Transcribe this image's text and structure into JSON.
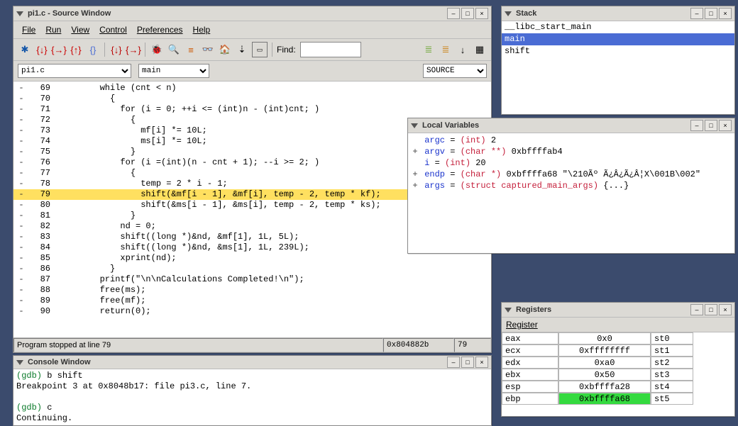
{
  "source_window": {
    "title": "pi1.c - Source Window",
    "menus": [
      "File",
      "Run",
      "View",
      "Control",
      "Preferences",
      "Help"
    ],
    "toolbar_icons": [
      "run-icon",
      "step-icon",
      "next-icon",
      "finish-icon",
      "continue-icon",
      "step-asm-icon",
      "next-asm-icon",
      "bug-icon",
      "search-icon",
      "breakpoints-icon",
      "watch-icon",
      "home-icon",
      "down-icon",
      "terminal-icon"
    ],
    "find_label": "Find:",
    "right_icons": [
      "stack-icon",
      "regs-icon",
      "down-arrow-icon",
      "frame-icon"
    ],
    "file_select": "pi1.c",
    "func_select": "main",
    "mode_select": "SOURCE",
    "code": [
      {
        "n": 69,
        "t": "        while (cnt < n)"
      },
      {
        "n": 70,
        "t": "          {"
      },
      {
        "n": 71,
        "t": "            for (i = 0; ++i <= (int)n - (int)cnt; )"
      },
      {
        "n": 72,
        "t": "              {"
      },
      {
        "n": 73,
        "t": "                mf[i] *= 10L;"
      },
      {
        "n": 74,
        "t": "                ms[i] *= 10L;"
      },
      {
        "n": 75,
        "t": "              }"
      },
      {
        "n": 76,
        "t": "            for (i =(int)(n - cnt + 1); --i >= 2; )"
      },
      {
        "n": 77,
        "t": "              {"
      },
      {
        "n": 78,
        "t": "                temp = 2 * i - 1;"
      },
      {
        "n": 79,
        "t": "                shift(&mf[i - 1], &mf[i], temp - 2, temp * kf);",
        "hl": true
      },
      {
        "n": 80,
        "t": "                shift(&ms[i - 1], &ms[i], temp - 2, temp * ks);"
      },
      {
        "n": 81,
        "t": "              }"
      },
      {
        "n": 82,
        "t": "            nd = 0;"
      },
      {
        "n": 83,
        "t": "            shift((long *)&nd, &mf[1], 1L, 5L);"
      },
      {
        "n": 84,
        "t": "            shift((long *)&nd, &ms[1], 1L, 239L);"
      },
      {
        "n": 85,
        "t": "            xprint(nd);"
      },
      {
        "n": 86,
        "t": "          }"
      },
      {
        "n": 87,
        "t": "        printf(\"\\n\\nCalculations Completed!\\n\");"
      },
      {
        "n": 88,
        "t": "        free(ms);"
      },
      {
        "n": 89,
        "t": "        free(mf);"
      },
      {
        "n": 90,
        "t": "        return(0);"
      }
    ],
    "status_msg": "Program stopped at line 79",
    "status_addr": "0x804882b",
    "status_line": "79"
  },
  "stack_window": {
    "title": "Stack",
    "items": [
      {
        "label": "__libc_start_main",
        "sel": false
      },
      {
        "label": "main",
        "sel": true
      },
      {
        "label": "shift",
        "sel": false
      }
    ]
  },
  "locals_window": {
    "title": "Local Variables",
    "vars": [
      {
        "exp": " ",
        "name": "argc",
        "type": "(int)",
        "val": "2"
      },
      {
        "exp": "+",
        "name": "argv",
        "type": "(char **)",
        "val": "0xbffffab4"
      },
      {
        "exp": " ",
        "name": "i",
        "type": "(int)",
        "val": "20"
      },
      {
        "exp": "+",
        "name": "endp",
        "type": "(char *)",
        "val": "0xbffffa68 \"\\210Ãº Ã¿Â¿Ã¿Â¦X\\001B\\002\""
      },
      {
        "exp": "+",
        "name": "args",
        "type": "(struct captured_main_args)",
        "val": "{...}"
      }
    ]
  },
  "registers_window": {
    "title": "Registers",
    "header": "Register",
    "rows": [
      {
        "name": "eax",
        "val": "0x0",
        "st": "st0"
      },
      {
        "name": "ecx",
        "val": "0xffffffff",
        "st": "st1"
      },
      {
        "name": "edx",
        "val": "0xa0",
        "st": "st2"
      },
      {
        "name": "ebx",
        "val": "0x50",
        "st": "st3"
      },
      {
        "name": "esp",
        "val": "0xbffffa28",
        "st": "st4"
      },
      {
        "name": "ebp",
        "val": "0xbffffa68",
        "st": "st5",
        "green": true
      }
    ]
  },
  "console_window": {
    "title": "Console Window",
    "lines": [
      {
        "p": "(gdb) ",
        "t": "b shift"
      },
      {
        "p": "",
        "t": "Breakpoint 3 at 0x8048b17: file pi3.c, line 7."
      },
      {
        "p": "",
        "t": ""
      },
      {
        "p": "(gdb) ",
        "t": "c"
      },
      {
        "p": "",
        "t": "Continuing."
      }
    ]
  }
}
